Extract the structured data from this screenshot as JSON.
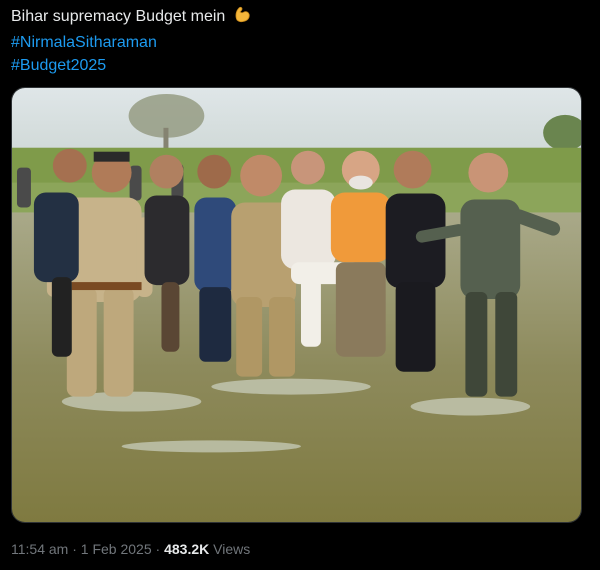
{
  "post": {
    "text_line1": "Bihar supremacy Budget mein",
    "emoji": "flexed-biceps-emoji",
    "hashtags": [
      "#NirmalaSitharaman",
      "#Budget2025"
    ],
    "media": {
      "kind": "photo",
      "alt": ""
    },
    "time": "11:54 am",
    "separator": "·",
    "date": "1 Feb 2025",
    "separator2": "·",
    "views_count": "483.2K",
    "views_label": "Views"
  },
  "colors": {
    "background": "#000000",
    "text": "#e7e9ea",
    "link": "#1d9bf0",
    "muted": "#71767b"
  }
}
